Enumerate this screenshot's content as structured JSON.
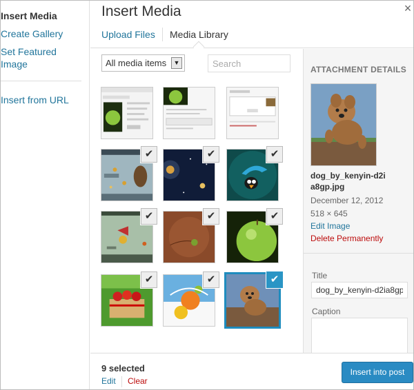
{
  "menu": {
    "items": [
      {
        "label": "Insert Media",
        "active": true
      },
      {
        "label": "Create Gallery"
      },
      {
        "label": "Set Featured Image"
      },
      {
        "label": "Insert from URL"
      }
    ]
  },
  "frame": {
    "title": "Insert Media",
    "close_glyph": "×"
  },
  "router": {
    "tabs": [
      {
        "label": "Upload Files"
      },
      {
        "label": "Media Library",
        "active": true
      }
    ]
  },
  "toolbar": {
    "filter_selected": "All media items",
    "filter_arrow": "▼",
    "search_placeholder": "Search"
  },
  "grid": {
    "check_glyph": "✔",
    "items": [
      {
        "name": "screenshot-edit-media",
        "checked": false
      },
      {
        "name": "screenshot-apple-post",
        "checked": false
      },
      {
        "name": "screenshot-add-new-media",
        "checked": false
      },
      {
        "name": "game-scene-1",
        "checked": true
      },
      {
        "name": "space-scene",
        "checked": true
      },
      {
        "name": "parachute-bird",
        "checked": true
      },
      {
        "name": "game-scene-2",
        "checked": true
      },
      {
        "name": "green-ball-brown",
        "checked": true
      },
      {
        "name": "green-apple",
        "checked": true
      },
      {
        "name": "strawberry-basket",
        "checked": true
      },
      {
        "name": "fruit-splash",
        "checked": true
      },
      {
        "name": "dog-jumping",
        "checked": true,
        "current": true
      }
    ]
  },
  "details": {
    "heading": "Attachment Details",
    "filename": "dog_by_kenyin-d2ia8gp.jpg",
    "date": "December 12, 2012",
    "dimensions": "518 × 645",
    "edit_label": "Edit Image",
    "delete_label": "Delete Permanently",
    "title_label": "Title",
    "title_value": "dog_by_kenyin-d2ia8gp",
    "caption_label": "Caption"
  },
  "footer": {
    "selected_count": "9 selected",
    "edit_label": "Edit",
    "clear_label": "Clear",
    "insert_label": "Insert into post"
  },
  "colors": {
    "link": "#21759b",
    "delete": "#bc0b0b",
    "primary_button": "#2a8bc3",
    "selection_blue": "#1e8cbe"
  }
}
